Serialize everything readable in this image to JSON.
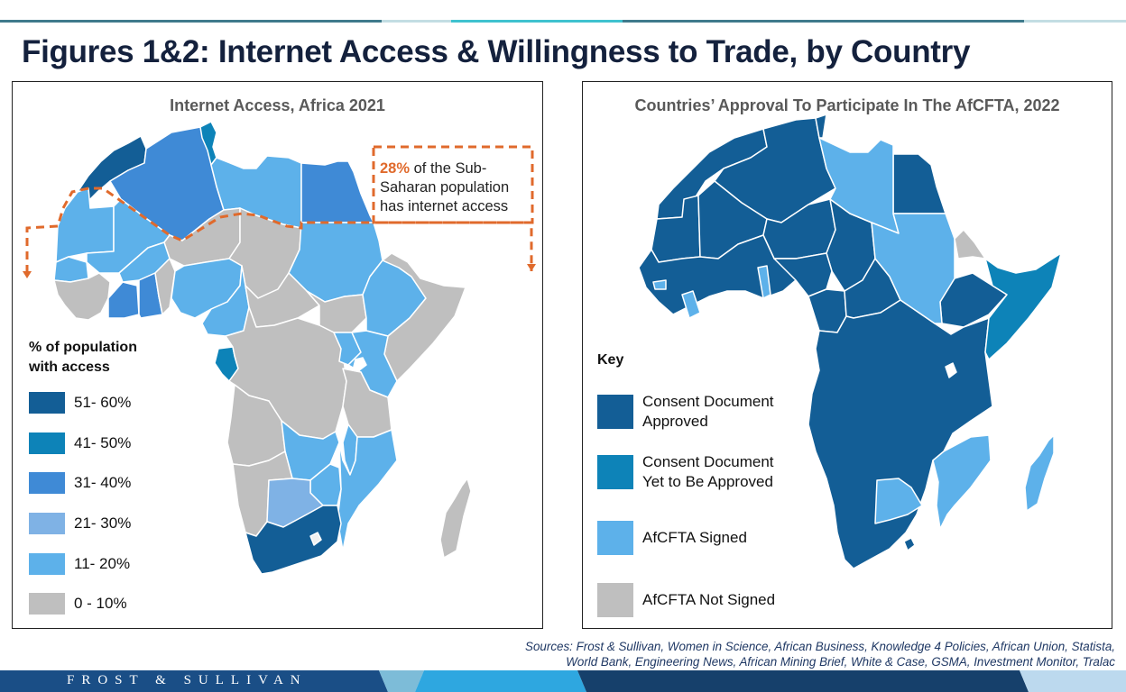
{
  "header": {
    "title": "Figures 1&2: Internet Access & Willingness to Trade, by Country"
  },
  "colors": {
    "title": "#14213d",
    "accent_orange": "#e06a2c",
    "border_white": "#ffffff"
  },
  "left_map": {
    "title": "Internet Access, Africa 2021",
    "callout": {
      "highlight": "28%",
      "text": " of the Sub-Saharan population has internet access"
    },
    "legend": {
      "title_line1": "% of population",
      "title_line2": "with access",
      "items": [
        {
          "label": "51- 60%",
          "color": "#135e96"
        },
        {
          "label": "41- 50%",
          "color": "#0d83b8"
        },
        {
          "label": "31- 40%",
          "color": "#3f8ad6"
        },
        {
          "label": "21- 30%",
          "color": "#7fb2e5"
        },
        {
          "label": "11- 20%",
          "color": "#5db1ea"
        },
        {
          "label": "0 - 10%",
          "color": "#bfbfbf"
        }
      ]
    },
    "regions": [
      {
        "name": "Morocco",
        "category": "51- 60%"
      },
      {
        "name": "Algeria",
        "category": "31- 40%"
      },
      {
        "name": "Tunisia",
        "category": "41- 50%"
      },
      {
        "name": "Libya",
        "category": "11- 20%"
      },
      {
        "name": "Egypt",
        "category": "31- 40%"
      },
      {
        "name": "Mauritania",
        "category": "11- 20%"
      },
      {
        "name": "Mali",
        "category": "11- 20%"
      },
      {
        "name": "Niger",
        "category": "0 - 10%"
      },
      {
        "name": "Chad",
        "category": "0 - 10%"
      },
      {
        "name": "Sudan",
        "category": "11- 20%"
      },
      {
        "name": "Senegal",
        "category": "11- 20%"
      },
      {
        "name": "Guinea",
        "category": "0 - 10%"
      },
      {
        "name": "Burkina Faso",
        "category": "11- 20%"
      },
      {
        "name": "Cote d'Ivoire",
        "category": "31- 40%"
      },
      {
        "name": "Ghana",
        "category": "31- 40%"
      },
      {
        "name": "Nigeria",
        "category": "11- 20%"
      },
      {
        "name": "Cameroon",
        "category": "11- 20%"
      },
      {
        "name": "Central African Republic",
        "category": "0 - 10%"
      },
      {
        "name": "South Sudan",
        "category": "0 - 10%"
      },
      {
        "name": "Ethiopia",
        "category": "11- 20%"
      },
      {
        "name": "Somalia",
        "category": "0 - 10%"
      },
      {
        "name": "Gabon",
        "category": "41- 50%"
      },
      {
        "name": "DR Congo",
        "category": "0 - 10%"
      },
      {
        "name": "Kenya",
        "category": "11- 20%"
      },
      {
        "name": "Uganda",
        "category": "11- 20%"
      },
      {
        "name": "Tanzania",
        "category": "0 - 10%"
      },
      {
        "name": "Angola",
        "category": "0 - 10%"
      },
      {
        "name": "Zambia",
        "category": "11- 20%"
      },
      {
        "name": "Malawi",
        "category": "11- 20%"
      },
      {
        "name": "Mozambique",
        "category": "11- 20%"
      },
      {
        "name": "Zimbabwe",
        "category": "11- 20%"
      },
      {
        "name": "Namibia",
        "category": "0 - 10%"
      },
      {
        "name": "Botswana",
        "category": "21- 30%"
      },
      {
        "name": "South Africa",
        "category": "51- 60%"
      },
      {
        "name": "Madagascar",
        "category": "0 - 10%"
      }
    ]
  },
  "right_map": {
    "title": "Countries’ Approval To Participate In The AfCFTA, 2022",
    "legend": {
      "title": "Key",
      "items": [
        {
          "label_line1": "Consent Document",
          "label_line2": "Approved",
          "color": "#135e96"
        },
        {
          "label_line1": "Consent Document",
          "label_line2": "Yet to Be Approved",
          "color": "#0d83b8"
        },
        {
          "label_line1": "AfCFTA Signed",
          "label_line2": "",
          "color": "#5db1ea"
        },
        {
          "label_line1": "AfCFTA Not Signed",
          "label_line2": "",
          "color": "#bfbfbf"
        }
      ]
    },
    "regions": [
      {
        "name": "Libya",
        "category": "AfCFTA Signed"
      },
      {
        "name": "Sudan",
        "category": "AfCFTA Signed"
      },
      {
        "name": "South Sudan",
        "category": "AfCFTA Signed"
      },
      {
        "name": "Eritrea",
        "category": "AfCFTA Not Signed"
      },
      {
        "name": "Somalia",
        "category": "Consent Document Yet to Be Approved"
      },
      {
        "name": "Benin",
        "category": "AfCFTA Signed"
      },
      {
        "name": "Liberia",
        "category": "AfCFTA Signed"
      },
      {
        "name": "Guinea-Bissau",
        "category": "AfCFTA Signed"
      },
      {
        "name": "Mozambique",
        "category": "AfCFTA Signed"
      },
      {
        "name": "Botswana",
        "category": "AfCFTA Signed"
      },
      {
        "name": "Madagascar",
        "category": "AfCFTA Signed"
      },
      {
        "name": "Other countries",
        "category": "Consent Document Approved"
      }
    ]
  },
  "sources": {
    "line1": "Sources: Frost & Sullivan, Women in Science, African Business, Knowledge 4 Policies, African Union, Statista,",
    "line2": "World Bank, Engineering News, African Mining Brief, White & Case, GSMA, Investment Monitor, Tralac"
  },
  "footer": {
    "brand": "FROST & SULLIVAN",
    "colors": [
      "#1a4e86",
      "#7dbcd8",
      "#2ea7e0",
      "#16406b",
      "#bcd9ee"
    ]
  }
}
